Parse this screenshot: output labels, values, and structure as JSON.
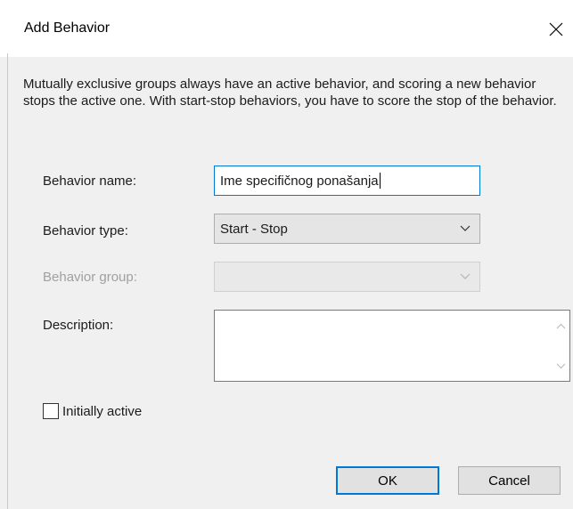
{
  "dialog": {
    "title": "Add Behavior",
    "close_icon": "close-icon"
  },
  "description_text": "Mutually exclusive groups always have an active behavior, and scoring a new behavior stops the active one. With start-stop behaviors, you have to score the stop of the behavior.",
  "form": {
    "behavior_name": {
      "label": "Behavior name:",
      "value": "Ime specifičnog ponašanja"
    },
    "behavior_type": {
      "label": "Behavior type:",
      "value": "Start - Stop"
    },
    "behavior_group": {
      "label": "Behavior group:",
      "value": "",
      "disabled": true
    },
    "description": {
      "label": "Description:",
      "value": ""
    },
    "initially_active": {
      "label": "Initially active",
      "checked": false
    }
  },
  "buttons": {
    "ok": "OK",
    "cancel": "Cancel"
  },
  "colors": {
    "focus_border": "#0078d7",
    "background": "#f0f0f0"
  }
}
